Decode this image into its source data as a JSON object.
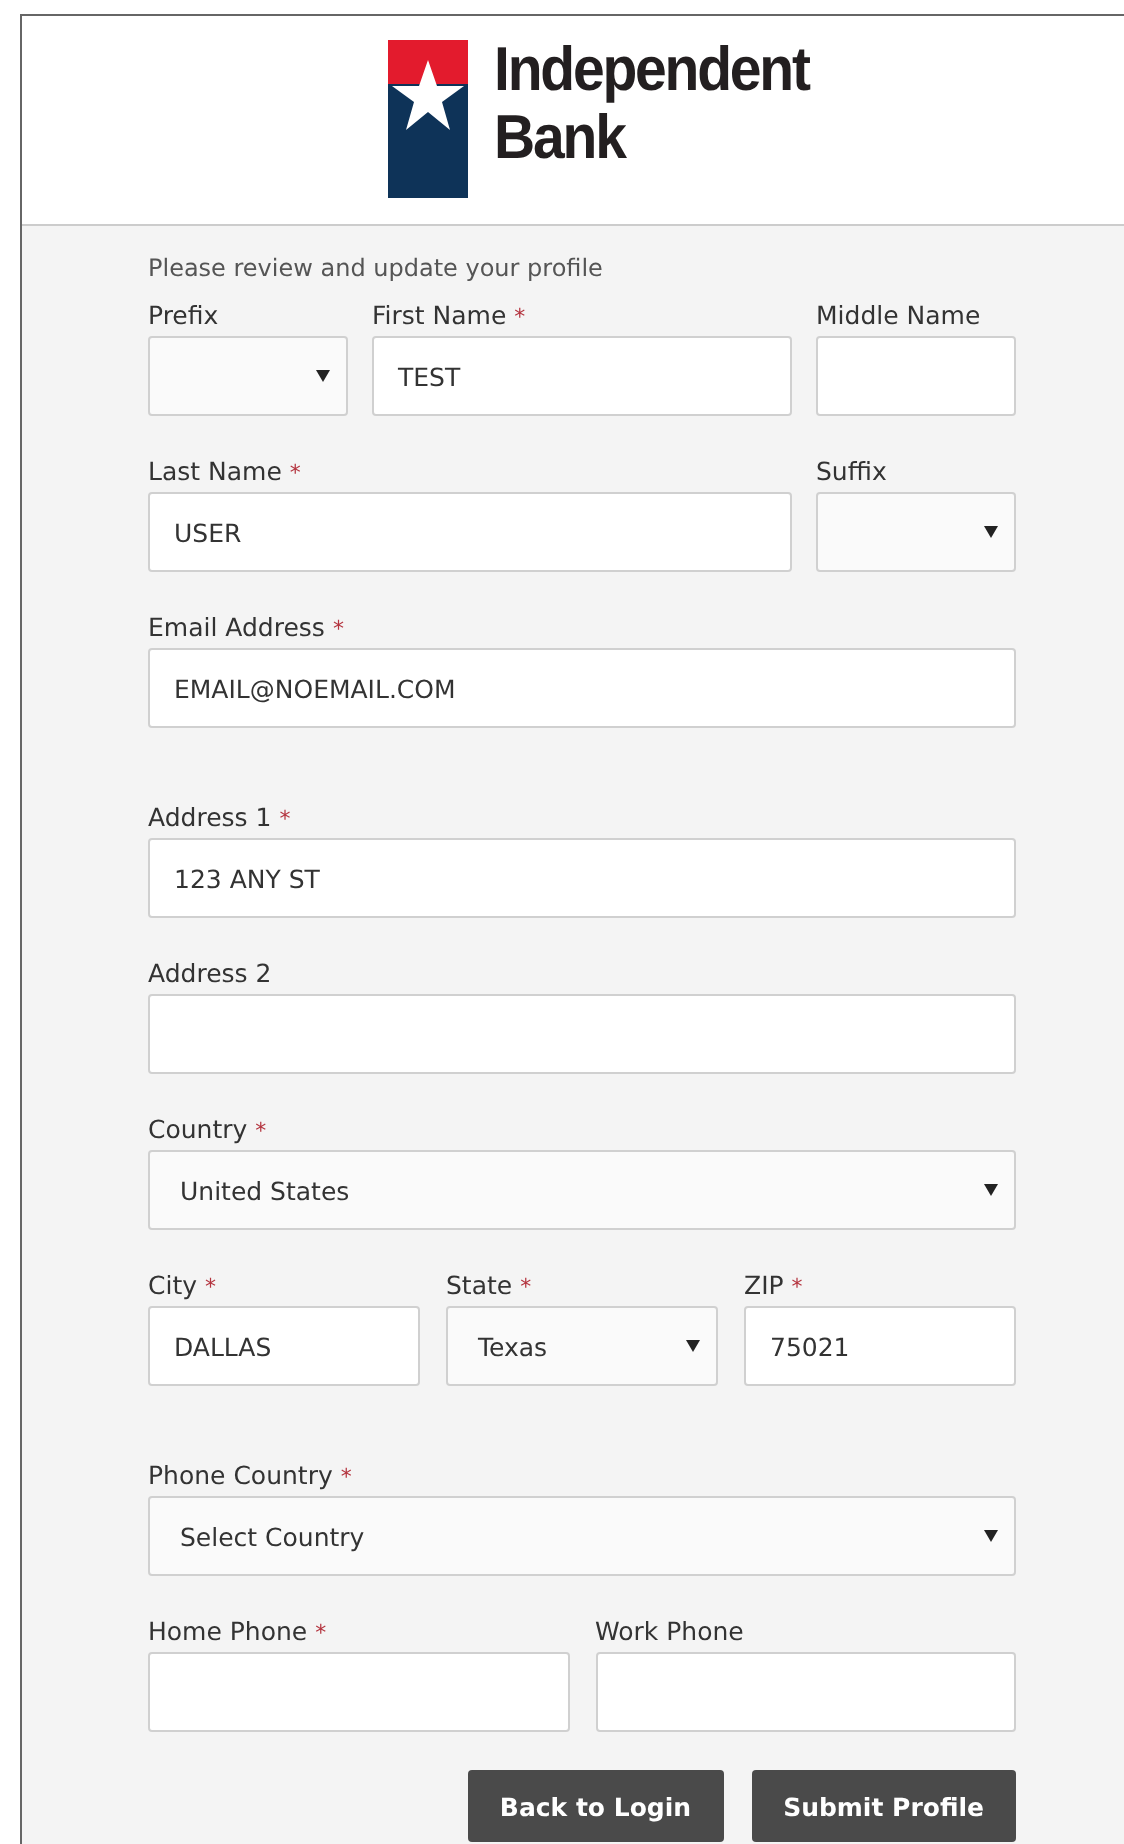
{
  "logo": {
    "lines": [
      "Independent",
      "Bank"
    ]
  },
  "intro": "Please review and update your profile",
  "sections": [
    {
      "rows": [
        {
          "fields": [
            {
              "label": "Prefix",
              "kind": "select"
            },
            {
              "label": "First Name",
              "required_mark": "*",
              "kind": "text",
              "value": "TEST"
            },
            {
              "label": "Middle Name",
              "kind": "text"
            }
          ]
        },
        {
          "fields": [
            {
              "label": "Last Name",
              "required_mark": "*",
              "kind": "text",
              "value": "USER"
            },
            {
              "label": "Suffix",
              "kind": "select"
            }
          ]
        },
        {
          "fields": [
            {
              "label": "Email Address",
              "required_mark": "*",
              "kind": "text",
              "value": "EMAIL@NOEMAIL.COM"
            }
          ]
        }
      ]
    },
    {
      "rows": [
        {
          "fields": [
            {
              "label": "Address 1",
              "required_mark": "*",
              "kind": "text",
              "value": "123 ANY ST"
            }
          ]
        },
        {
          "fields": [
            {
              "label": "Address 2",
              "kind": "text"
            }
          ]
        },
        {
          "fields": [
            {
              "label": "Country",
              "required_mark": "*",
              "kind": "select",
              "value": "United States"
            }
          ]
        },
        {
          "fields": [
            {
              "label": "City",
              "required_mark": "*",
              "kind": "text",
              "value": "DALLAS"
            },
            {
              "label": "State",
              "required_mark": "*",
              "kind": "select",
              "value": "Texas"
            },
            {
              "label": "ZIP",
              "required_mark": "*",
              "kind": "text",
              "value": "75021"
            }
          ]
        }
      ]
    },
    {
      "rows": [
        {
          "fields": [
            {
              "label": "Phone Country",
              "required_mark": "*",
              "kind": "select",
              "value": "Select Country"
            }
          ]
        },
        {
          "fields": [
            {
              "label": "Home Phone",
              "required_mark": "*",
              "kind": "text"
            },
            {
              "label": "Work Phone",
              "kind": "text"
            }
          ]
        }
      ]
    }
  ],
  "buttons": [
    "Back to Login",
    "Submit Profile"
  ]
}
